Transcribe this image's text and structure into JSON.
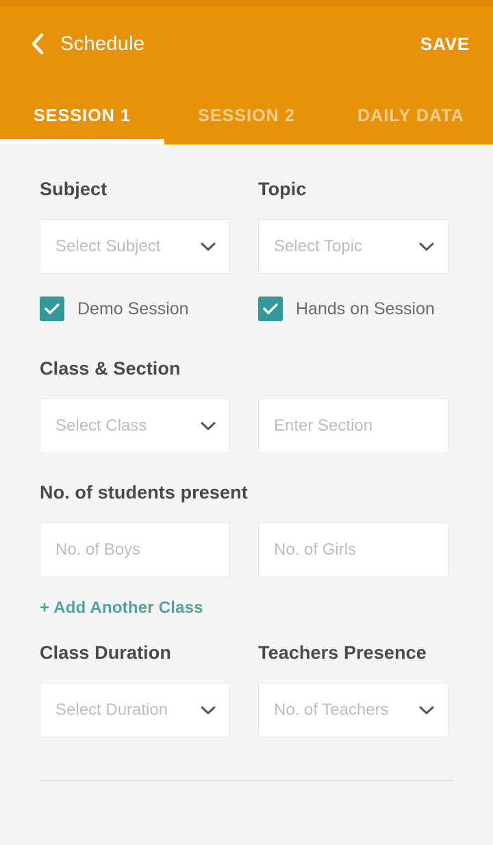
{
  "header": {
    "back_icon": "chevron-left-icon",
    "title": "Schedule",
    "save_label": "SAVE"
  },
  "tabs": [
    {
      "label": "SESSION 1",
      "active": true
    },
    {
      "label": "SESSION 2",
      "active": false
    },
    {
      "label": "DAILY DATA",
      "active": false
    }
  ],
  "form": {
    "subject": {
      "label": "Subject",
      "placeholder": "Select Subject",
      "value": "",
      "icon": "chevron-down-icon"
    },
    "topic": {
      "label": "Topic",
      "placeholder": "Select Topic",
      "value": "",
      "icon": "chevron-down-icon"
    },
    "demo_session": {
      "label": "Demo Session",
      "checked": true
    },
    "hands_on_session": {
      "label": "Hands on Session",
      "checked": true
    },
    "class_section": {
      "label": "Class & Section",
      "class_placeholder": "Select Class",
      "class_value": "",
      "section_placeholder": "Enter Section",
      "section_value": ""
    },
    "students_present": {
      "label": "No. of students present",
      "boys_placeholder": "No. of Boys",
      "boys_value": "",
      "girls_placeholder": "No. of Girls",
      "girls_value": ""
    },
    "add_another_class": {
      "label": "+ Add Another Class"
    },
    "class_duration": {
      "label": "Class Duration",
      "placeholder": "Select Duration",
      "value": "",
      "icon": "chevron-down-icon"
    },
    "teachers_presence": {
      "label": "Teachers Presence",
      "placeholder": "No. of Teachers",
      "value": "",
      "icon": "chevron-down-icon"
    }
  },
  "colors": {
    "accent_orange": "#e89209",
    "status_orange": "#e08707",
    "teal": "#31999b",
    "link_teal": "#4fa3a0",
    "page_background": "#f4f4f4",
    "label_text": "#4a4a4a",
    "placeholder_text": "#bdbdbd"
  }
}
